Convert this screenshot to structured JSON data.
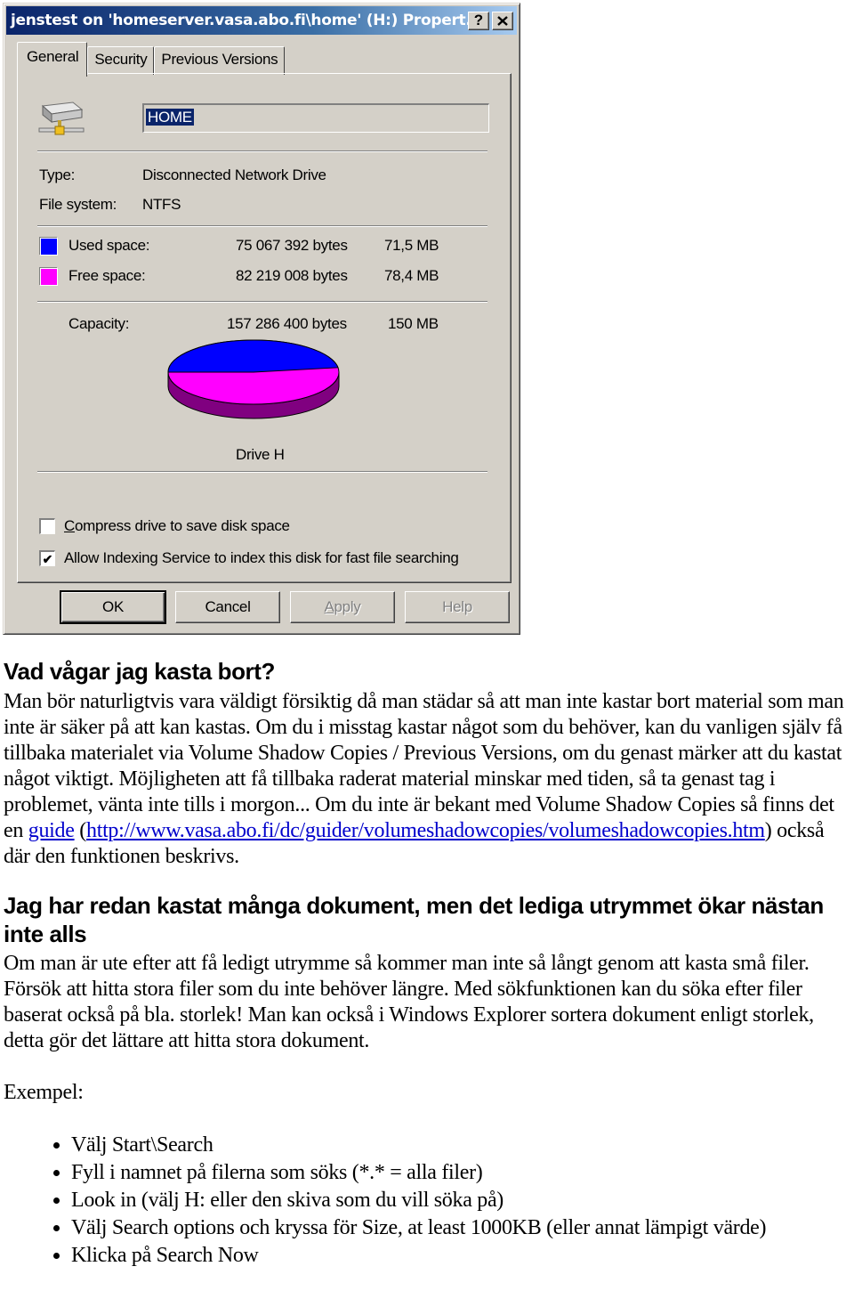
{
  "dialog": {
    "title": "jenstest on 'homeserver.vasa.abo.fi\\home' (H:) Propert...",
    "help_button": "?",
    "close_button": "✕",
    "tabs": [
      {
        "label": "General",
        "active": true
      },
      {
        "label": "Security",
        "active": false
      },
      {
        "label": "Previous Versions",
        "active": false
      }
    ],
    "drive_icon": "network-drive-icon",
    "name_value": "HOME",
    "type_label": "Type:",
    "type_value": "Disconnected Network Drive",
    "fs_label": "File system:",
    "fs_value": "NTFS",
    "used": {
      "label": "Used space:",
      "bytes": "75 067 392 bytes",
      "size": "71,5 MB",
      "color": "#0000ff"
    },
    "free": {
      "label": "Free space:",
      "bytes": "82 219 008 bytes",
      "size": "78,4 MB",
      "color": "#ff00ff"
    },
    "capacity": {
      "label": "Capacity:",
      "bytes": "157 286 400 bytes",
      "size": "150 MB"
    },
    "pie": {
      "used_fraction": 0.477,
      "free_fraction": 0.523,
      "side_color": "#800080"
    },
    "drive_label": "Drive H",
    "compress": {
      "label": "Compress drive to save disk space",
      "checked": false
    },
    "indexing": {
      "label": "Allow Indexing Service to index this disk for fast file searching",
      "checked": true
    },
    "buttons": {
      "ok": "OK",
      "cancel": "Cancel",
      "apply": "Apply",
      "help": "Help"
    }
  },
  "doc": {
    "h1": "Vad vågar jag kasta bort?",
    "p1_before": "Man bör naturligtvis vara väldigt försiktig då man städar så att man inte kastar bort material som man inte är säker på att kan kastas. Om du i misstag kastar något som du behöver, kan du vanligen själv få tillbaka materialet via Volume Shadow Copies / Previous Versions, om du genast märker att du kastat något viktigt. Möjligheten att få tillbaka raderat material minskar med tiden, så ta genast tag i problemet, vänta inte tills i morgon... Om du inte är bekant med Volume Shadow Copies så finns det en ",
    "p1_link1": "guide",
    "p1_mid": " (",
    "p1_link2": "http://www.vasa.abo.fi/dc/guider/volumeshadowcopies/volumeshadowcopies.htm",
    "p1_after": ") också där den funktionen beskrivs.",
    "h2": "Jag har redan kastat många dokument, men det lediga utrymmet ökar nästan inte alls",
    "p2": "Om man är ute efter att få ledigt utrymme så kommer man inte så långt genom att kasta små filer. Försök att hitta stora filer som du inte behöver längre. Med sökfunktionen kan du söka efter filer baserat också på bla. storlek! Man kan också i Windows Explorer sortera dokument enligt storlek, detta gör det lättare att hitta stora dokument.",
    "example_label": "Exempel:",
    "steps": [
      "Välj Start\\Search",
      "Fyll i namnet på filerna som söks (*.* = alla filer)",
      "Look in (välj H: eller den skiva som du vill söka på)",
      "Välj Search options och kryssa för Size, at least 1000KB (eller annat lämpigt värde)",
      "Klicka på Search Now"
    ]
  }
}
